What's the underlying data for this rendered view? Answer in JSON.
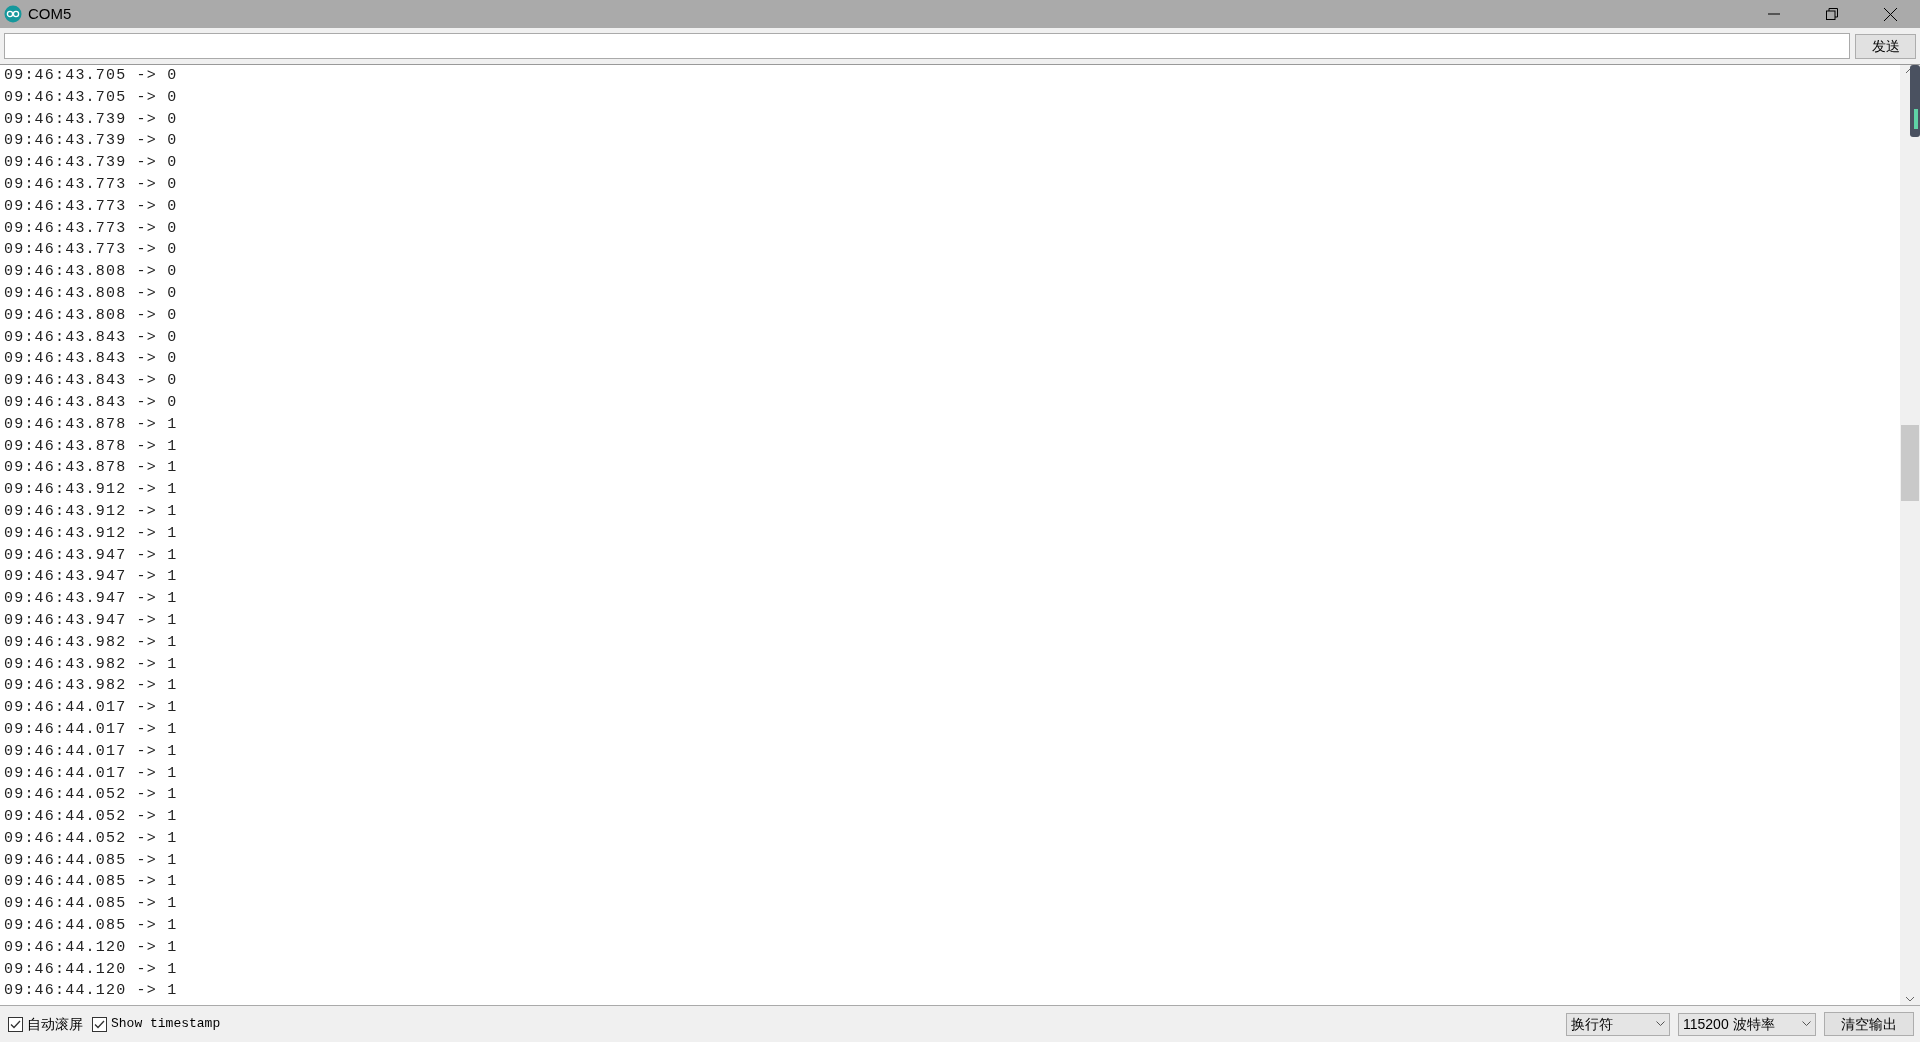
{
  "window": {
    "title": "COM5"
  },
  "send_button": "发送",
  "log_lines": [
    "09:46:43.705 -> 0",
    "09:46:43.705 -> 0",
    "09:46:43.739 -> 0",
    "09:46:43.739 -> 0",
    "09:46:43.739 -> 0",
    "09:46:43.773 -> 0",
    "09:46:43.773 -> 0",
    "09:46:43.773 -> 0",
    "09:46:43.773 -> 0",
    "09:46:43.808 -> 0",
    "09:46:43.808 -> 0",
    "09:46:43.808 -> 0",
    "09:46:43.843 -> 0",
    "09:46:43.843 -> 0",
    "09:46:43.843 -> 0",
    "09:46:43.843 -> 0",
    "09:46:43.878 -> 1",
    "09:46:43.878 -> 1",
    "09:46:43.878 -> 1",
    "09:46:43.912 -> 1",
    "09:46:43.912 -> 1",
    "09:46:43.912 -> 1",
    "09:46:43.947 -> 1",
    "09:46:43.947 -> 1",
    "09:46:43.947 -> 1",
    "09:46:43.947 -> 1",
    "09:46:43.982 -> 1",
    "09:46:43.982 -> 1",
    "09:46:43.982 -> 1",
    "09:46:44.017 -> 1",
    "09:46:44.017 -> 1",
    "09:46:44.017 -> 1",
    "09:46:44.017 -> 1",
    "09:46:44.052 -> 1",
    "09:46:44.052 -> 1",
    "09:46:44.052 -> 1",
    "09:46:44.085 -> 1",
    "09:46:44.085 -> 1",
    "09:46:44.085 -> 1",
    "09:46:44.085 -> 1",
    "09:46:44.120 -> 1",
    "09:46:44.120 -> 1",
    "09:46:44.120 -> 1"
  ],
  "options": [
    {
      "label": "自动滚屏",
      "checked": true
    },
    {
      "label": "Show timestamp",
      "checked": true
    }
  ],
  "dropdowns": [
    {
      "value": "换行符"
    },
    {
      "value": "115200 波特率"
    }
  ],
  "clear_button": "清空输出"
}
